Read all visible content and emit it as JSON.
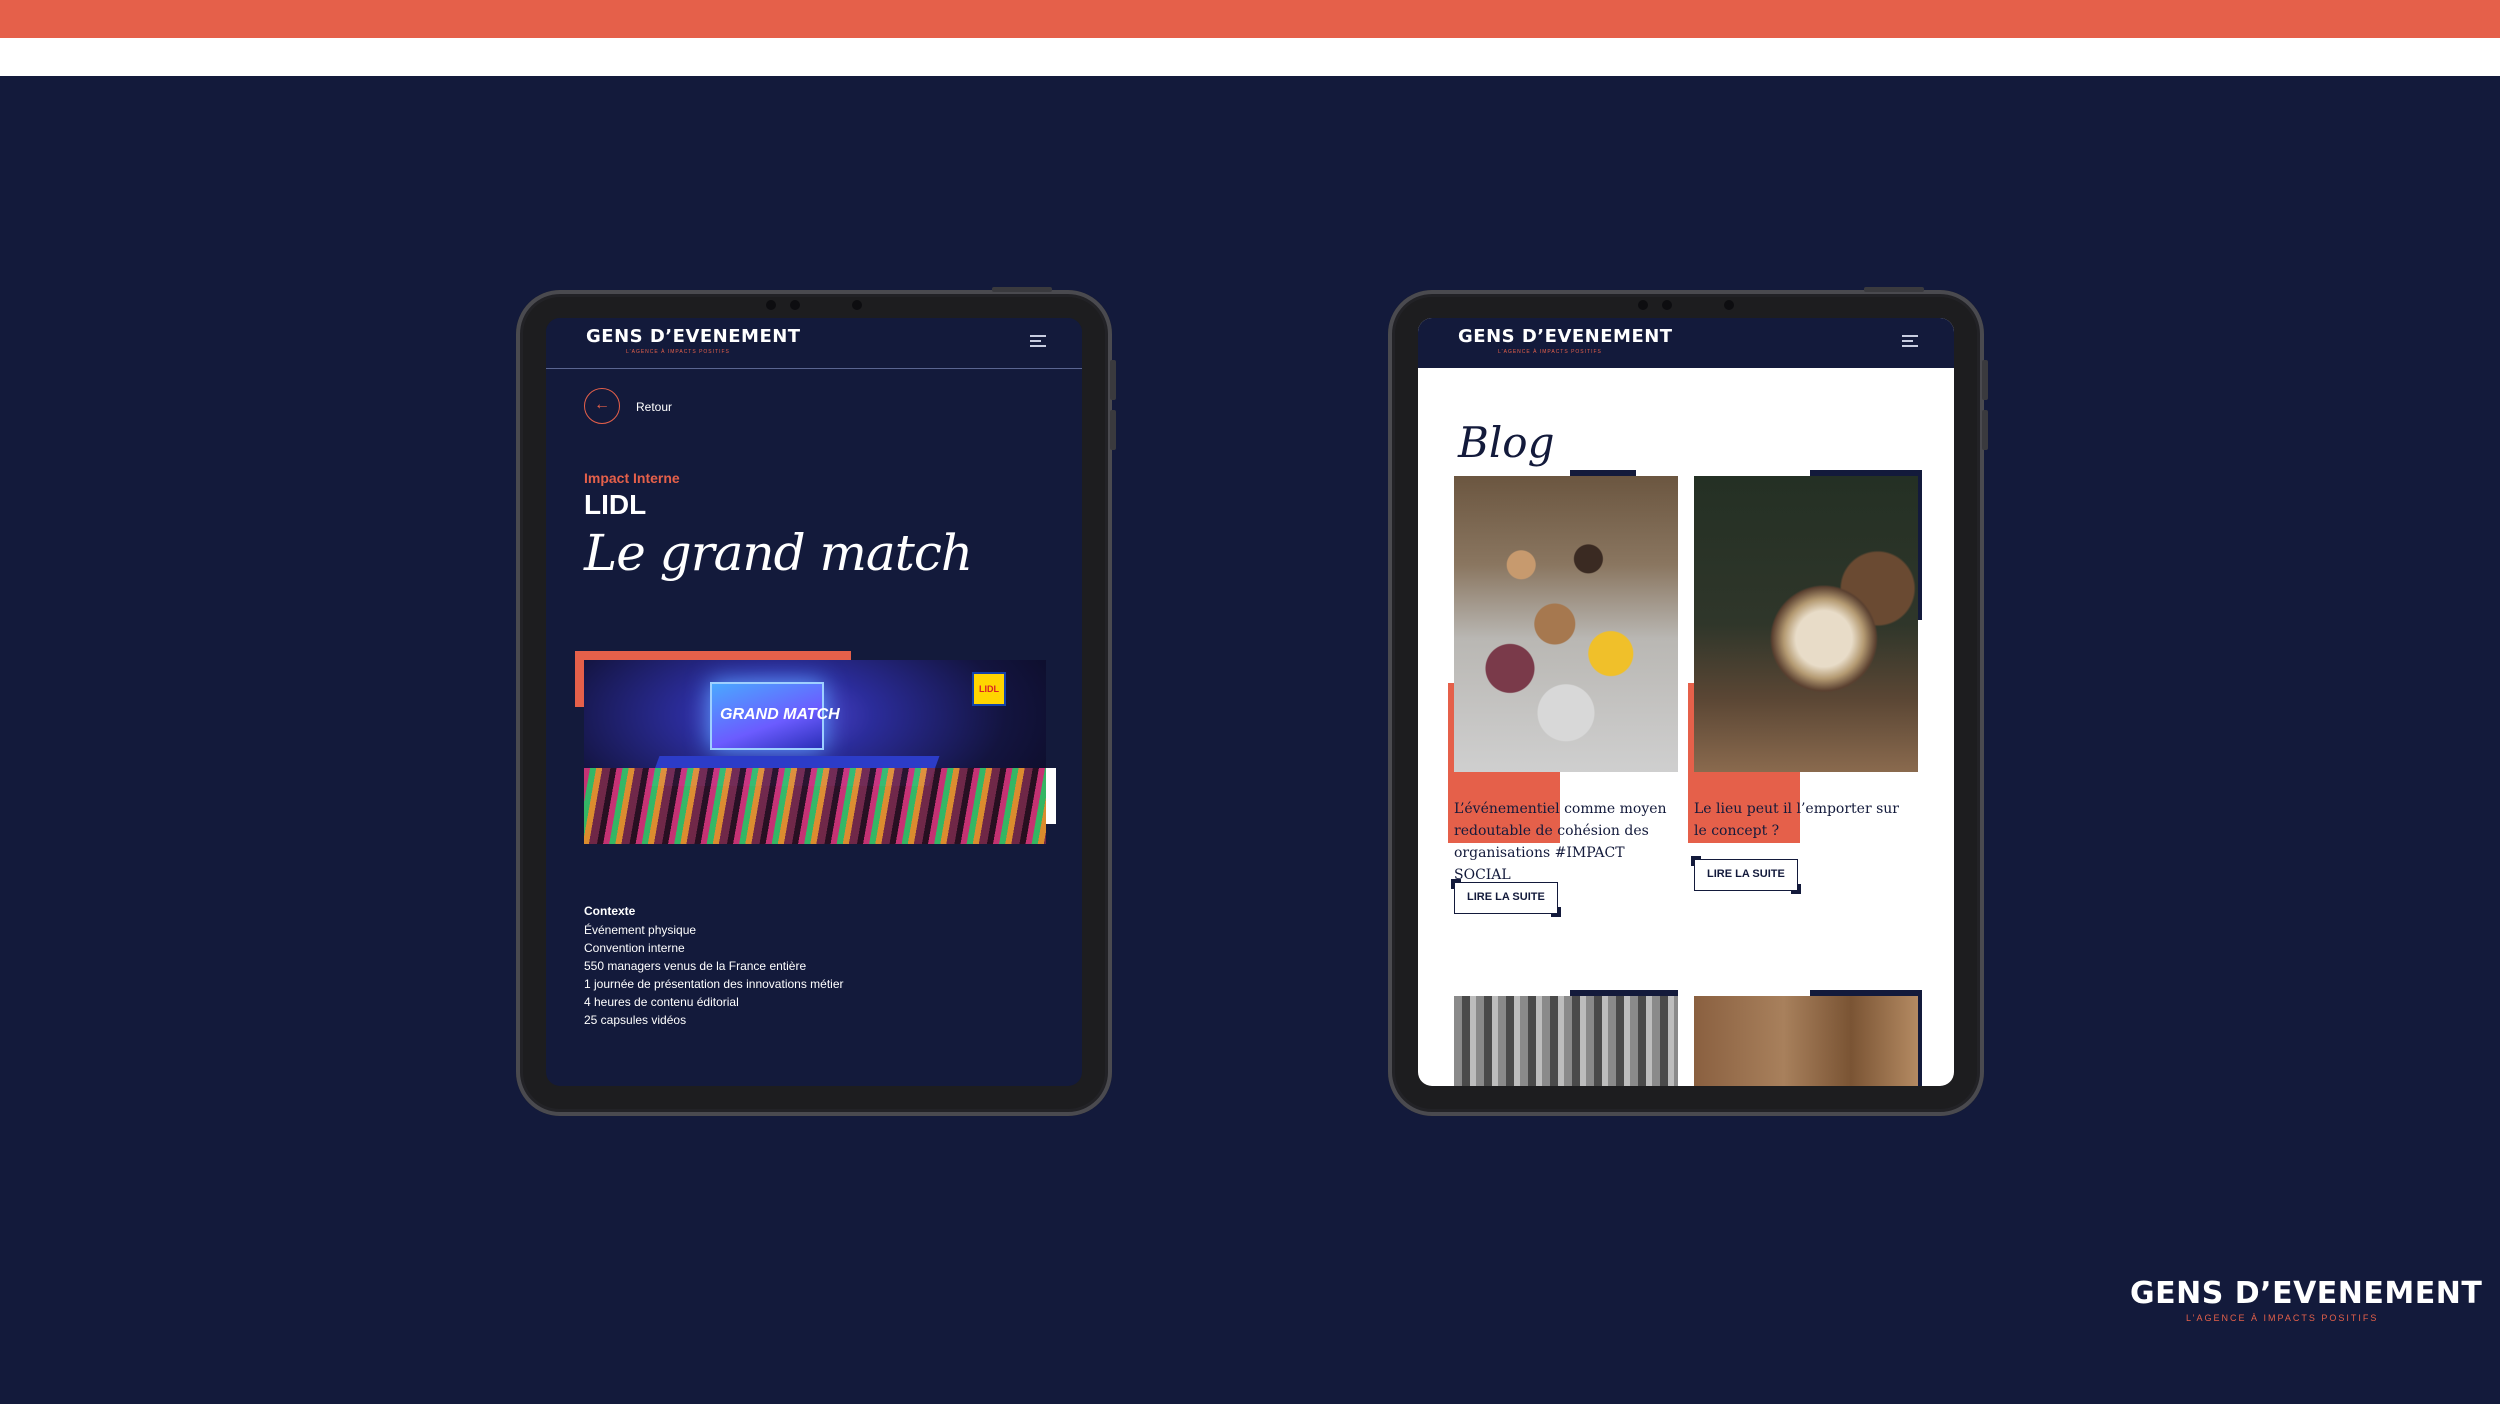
{
  "brand": {
    "name": "GENS D’EVENEMENT",
    "tagline": "L’AGENCE À IMPACTS POSITIFS",
    "accent_color": "#e5604a",
    "navy_color": "#131a3b"
  },
  "project_screen": {
    "back_label": "Retour",
    "category": "Impact Interne",
    "client": "LIDL",
    "title": "Le grand match",
    "photo_screen_text": "GRAND MATCH",
    "photo_badge": "LIDL",
    "context_title": "Contexte",
    "context_items": [
      "Événement physique",
      "Convention interne",
      "550 managers venus de la France entière",
      "1 journée de présentation des innovations métier",
      "4 heures de contenu éditorial",
      "25 capsules vidéos"
    ]
  },
  "blog_screen": {
    "title": "Blog",
    "posts": [
      {
        "caption": "L’événementiel comme moyen redoutable de cohésion des organisations #IMPACT SOCIAL",
        "button": "LIRE LA SUITE"
      },
      {
        "caption": "Le lieu peut il l’emporter sur le concept ?",
        "button": "LIRE LA SUITE"
      }
    ]
  }
}
